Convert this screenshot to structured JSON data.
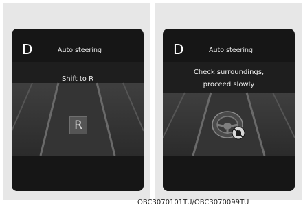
{
  "screens": [
    {
      "gear": "D",
      "mode_label": "Auto steering",
      "message": "Shift to R",
      "gear_indicator": "R",
      "icon": "reverse-gear-box"
    },
    {
      "gear": "D",
      "mode_label": "Auto steering",
      "message_line1": "Check surroundings,",
      "message_line2": "proceed slowly",
      "icon": "steering-wheel-hands-off-icon"
    }
  ],
  "caption": "OBC3070101TU/OBC3070099TU",
  "colors": {
    "screen_background": "#161616",
    "frame_background": "#e7e7e7",
    "text": "#f2f2f2"
  }
}
